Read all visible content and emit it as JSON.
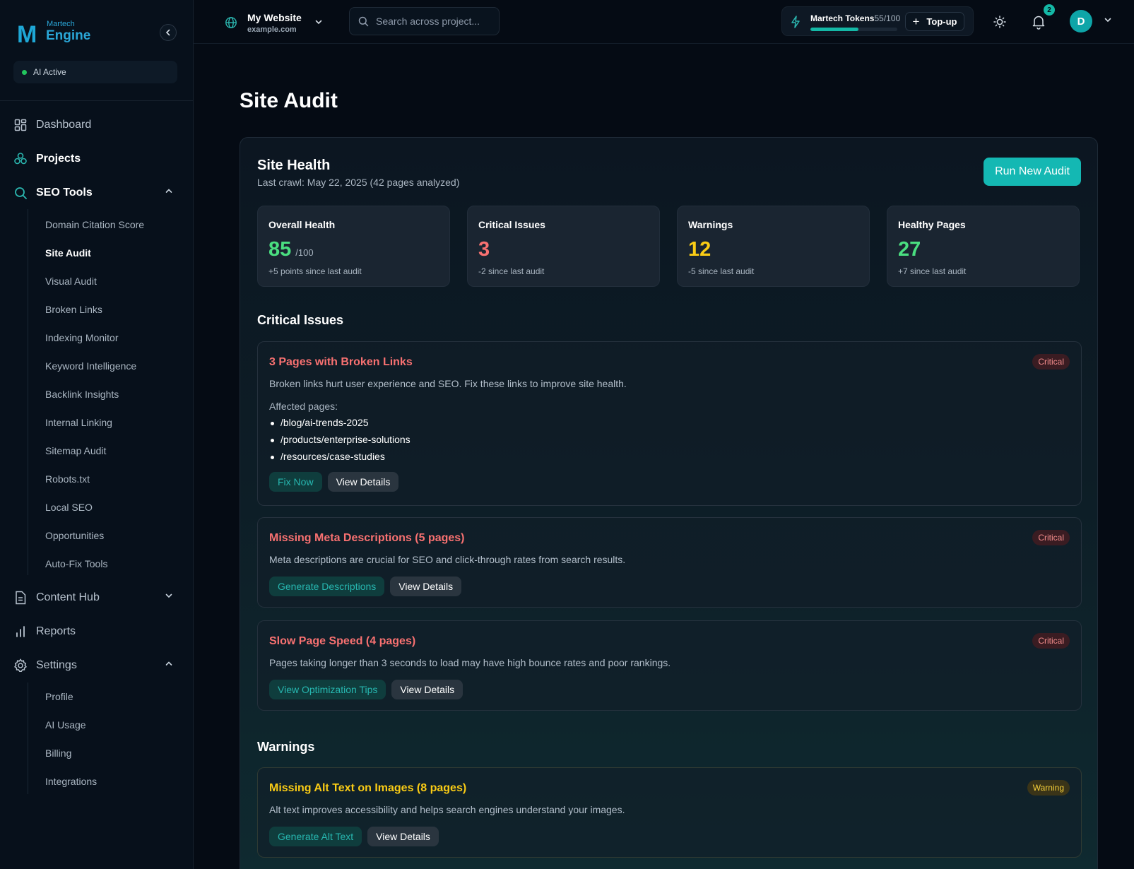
{
  "brand": {
    "small": "Martech",
    "big": "Engine",
    "mark": "M"
  },
  "status": {
    "label": "AI Active",
    "color": "#22c55e"
  },
  "sidebar": {
    "main": [
      {
        "label": "Dashboard",
        "icon": "grid-icon"
      },
      {
        "label": "Projects",
        "icon": "projects-icon"
      },
      {
        "label": "SEO Tools",
        "icon": "search-icon"
      }
    ],
    "seo_tools": [
      "Domain Citation Score",
      "Site Audit",
      "Visual Audit",
      "Broken Links",
      "Indexing Monitor",
      "Keyword Intelligence",
      "Backlink Insights",
      "Internal Linking",
      "Sitemap Audit",
      "Robots.txt",
      "Local SEO",
      "Opportunities",
      "Auto-Fix Tools"
    ],
    "content_hub": "Content Hub",
    "reports": "Reports",
    "settings": "Settings",
    "settings_items": [
      "Profile",
      "AI Usage",
      "Billing",
      "Integrations"
    ]
  },
  "topbar": {
    "site_name": "My Website",
    "site_domain": "example.com",
    "search_placeholder": "Search across project...",
    "tokens_label": "Martech Tokens",
    "tokens_count": "55/100",
    "tokens_fraction": 0.55,
    "topup_label": "Top-up",
    "notifications": "2",
    "avatar_initial": "D"
  },
  "page": {
    "title": "Site Audit"
  },
  "site_health": {
    "title": "Site Health",
    "subtitle": "Last crawl: May 22, 2025 (42 pages analyzed)",
    "run_button": "Run New Audit",
    "stats": [
      {
        "label": "Overall Health",
        "value": "85",
        "suffix": "/100",
        "delta": "+5 points since last audit",
        "color": "#4ade80"
      },
      {
        "label": "Critical Issues",
        "value": "3",
        "suffix": "",
        "delta": "-2 since last audit",
        "color": "#f87171"
      },
      {
        "label": "Warnings",
        "value": "12",
        "suffix": "",
        "delta": "-5 since last audit",
        "color": "#facc15"
      },
      {
        "label": "Healthy Pages",
        "value": "27",
        "suffix": "",
        "delta": "+7 since last audit",
        "color": "#4ade80"
      }
    ]
  },
  "critical_section": {
    "title": "Critical Issues",
    "issues": [
      {
        "title": "3 Pages with Broken Links",
        "badge": "Critical",
        "description": "Broken links hurt user experience and SEO. Fix these links to improve site health.",
        "affected_label": "Affected pages:",
        "affected": [
          "/blog/ai-trends-2025",
          "/products/enterprise-solutions",
          "/resources/case-studies"
        ],
        "primary": "Fix Now",
        "secondary": "View Details"
      },
      {
        "title": "Missing Meta Descriptions (5 pages)",
        "badge": "Critical",
        "description": "Meta descriptions are crucial for SEO and click-through rates from search results.",
        "primary": "Generate Descriptions",
        "secondary": "View Details"
      },
      {
        "title": "Slow Page Speed (4 pages)",
        "badge": "Critical",
        "description": "Pages taking longer than 3 seconds to load may have high bounce rates and poor rankings.",
        "primary": "View Optimization Tips",
        "secondary": "View Details"
      }
    ]
  },
  "warnings_section": {
    "title": "Warnings",
    "issues": [
      {
        "title": "Missing Alt Text on Images (8 pages)",
        "badge": "Warning",
        "description": "Alt text improves accessibility and helps search engines understand your images.",
        "primary": "Generate Alt Text",
        "secondary": "View Details"
      }
    ]
  }
}
